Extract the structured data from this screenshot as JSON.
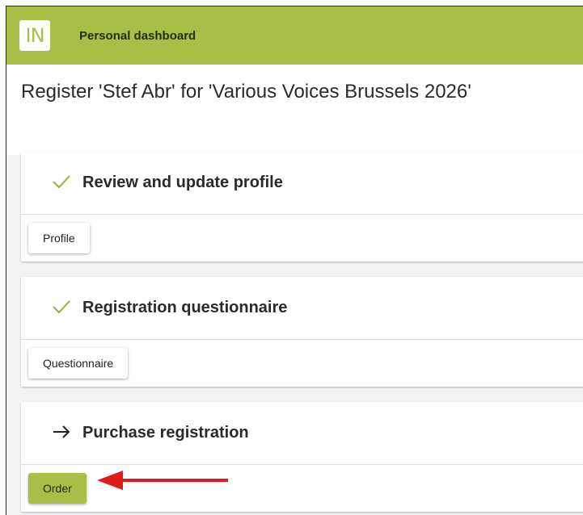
{
  "header": {
    "logo_text": "IN",
    "title": "Personal dashboard"
  },
  "page": {
    "title": "Register 'Stef Abr' for 'Various Voices Brussels 2026'"
  },
  "steps": [
    {
      "status_icon": "check-icon",
      "title": "Review and update profile",
      "button_label": "Profile",
      "completed": true
    },
    {
      "status_icon": "check-icon",
      "title": "Registration questionnaire",
      "button_label": "Questionnaire",
      "completed": true
    },
    {
      "status_icon": "arrow-right-icon",
      "title": "Purchase registration",
      "button_label": "Order",
      "completed": false
    }
  ],
  "colors": {
    "brand": "#a7bf47",
    "check": "#8fb340",
    "annotation_arrow": "#e01b1b"
  }
}
